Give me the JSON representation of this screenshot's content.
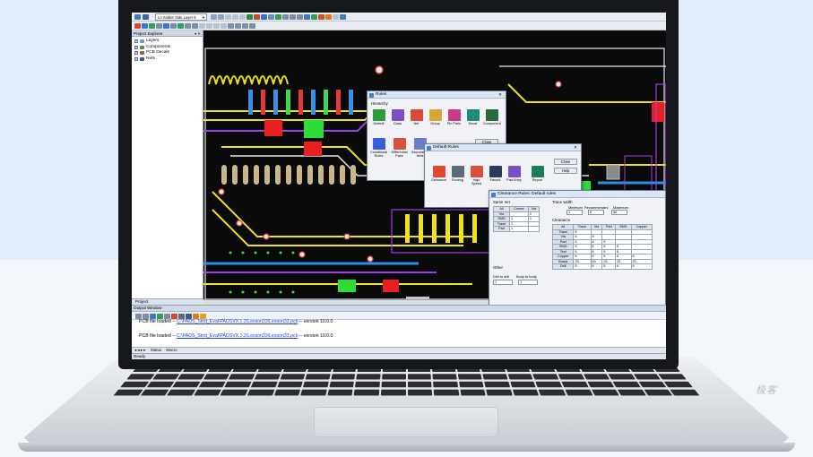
{
  "window": {
    "layer_combo": "Ln Solder Side Layer 6",
    "status_text": "Ready"
  },
  "project_explorer": {
    "title": "Project Explorer",
    "items": [
      {
        "label": "Layers"
      },
      {
        "label": "Components"
      },
      {
        "label": "PCB Decals"
      },
      {
        "label": "Nets"
      }
    ],
    "tab": "Project"
  },
  "rules_dialog": {
    "title": "Rules",
    "section": "Hierarchy",
    "tiles_row1": [
      "Default",
      "Class",
      "Net",
      "Group",
      "Pin Pairs",
      "Decal",
      "Component"
    ],
    "tiles_row2": [
      "Conditional Rules",
      "Differential Pairs",
      "Associations Nets"
    ],
    "close_label": "Close"
  },
  "default_rules_dialog": {
    "title": "Default Rules",
    "tiles": [
      "Clearance",
      "Routing",
      "High Speed",
      "Fanout",
      "Pad Entry",
      "Report"
    ],
    "close_label": "Close",
    "help_label": "Help"
  },
  "clearance_dialog": {
    "title": "Clearance Rules: Default rules",
    "same_net_label": "Same net",
    "same_net_headers": [
      "All",
      "Corner",
      "Via"
    ],
    "same_net_rows": [
      [
        "Via",
        "",
        "1"
      ],
      [
        "SMD",
        "1",
        "1"
      ],
      [
        "Trace",
        "1",
        ""
      ],
      [
        "Pad",
        "1",
        ""
      ]
    ],
    "trace_width_label": "Trace width",
    "trace_width_headers": [
      "Minimum",
      "Recommended",
      "Maximum"
    ],
    "trace_width_values": [
      "1",
      "6",
      "50"
    ],
    "clearance_label": "Clearance",
    "clearance_headers": [
      "All",
      "Trace",
      "Via",
      "Pad",
      "SMD",
      "Copper"
    ],
    "clearance_rows": [
      [
        "Trace",
        "6",
        "",
        "",
        "",
        ""
      ],
      [
        "Via",
        "6",
        "6",
        "",
        "",
        ""
      ],
      [
        "Pad",
        "6",
        "6",
        "6",
        "",
        ""
      ],
      [
        "SMD",
        "6",
        "6",
        "6",
        "6",
        ""
      ],
      [
        "Text",
        "6",
        "6",
        "6",
        "6",
        ""
      ],
      [
        "Copper",
        "6",
        "6",
        "6",
        "6",
        "6"
      ],
      [
        "Board",
        "25",
        "50",
        "25",
        "25",
        "25"
      ],
      [
        "Drill",
        "6",
        "6",
        "6",
        "6",
        "6"
      ]
    ],
    "other_label": "Other",
    "drill_label": "Drill to drill",
    "body_label": "Body to body",
    "drill_value": "1",
    "body_value": "1"
  },
  "output_window": {
    "title": "Output Window",
    "line1_prefix": "PCB file loaded --",
    "line1_link": "C:\\PADS_Stnd_Eval\\PADSVX.1.2\\Lesson33\\Lesson33.pcb",
    "line1_suffix": "-- version 10.0.0",
    "line2_prefix": "PCB file loaded --",
    "line2_link": "C:\\PADS_Stnd_Eval\\PADSVX.1.2\\Lesson33\\Lesson33.pcb",
    "line2_suffix": "-- version 10.0.0",
    "tabs": [
      "Status",
      "Macro"
    ]
  },
  "watermark": "极客"
}
